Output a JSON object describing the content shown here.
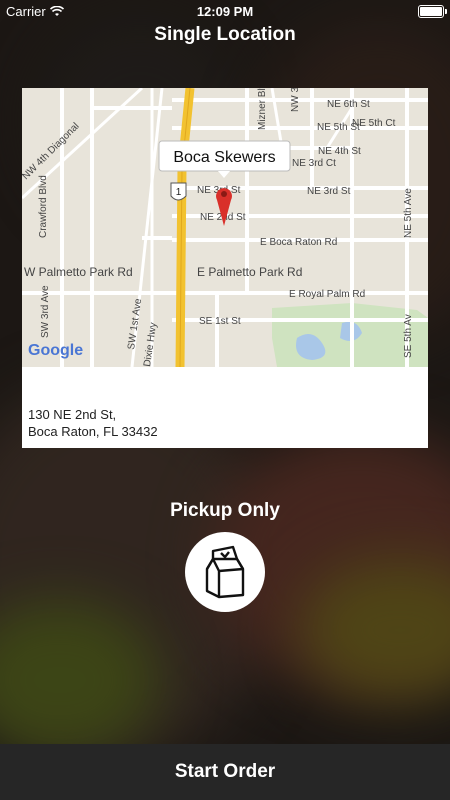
{
  "status_bar": {
    "carrier": "Carrier",
    "time": "12:09 PM"
  },
  "header": {
    "title": "Single Location"
  },
  "map": {
    "marker_label": "Boca Skewers",
    "shield_number": "1",
    "google_logo": "Google",
    "streets": [
      "NE 6th St",
      "NE 5th St",
      "NE 5th Ct",
      "NE 4th St",
      "NE 3rd Ct",
      "NE 3rd St",
      "NE 3rd St",
      "NE 2nd St",
      "E Boca Raton Rd",
      "W Palmetto Park Rd",
      "E Palmetto Park Rd",
      "E Royal Palm Rd",
      "SE 1st St",
      "NW 4th Diagonal",
      "Crawford Blvd",
      "SW 3rd Ave",
      "SW 1st Ave",
      "Dixie Hwy",
      "NE 5th Ave",
      "SE 5th Av",
      "NW 3rd",
      "Mizner Blvd"
    ]
  },
  "location": {
    "address_line1": "130 NE 2nd St,",
    "address_line2": "Boca Raton, FL 33432"
  },
  "pickup": {
    "label": "Pickup Only",
    "icon": "bag-icon"
  },
  "footer": {
    "start_order_label": "Start Order"
  },
  "colors": {
    "footer_bg": "#262626",
    "card_bg": "#ffffff",
    "marker": "#d9302a",
    "highway": "#f2c230"
  }
}
